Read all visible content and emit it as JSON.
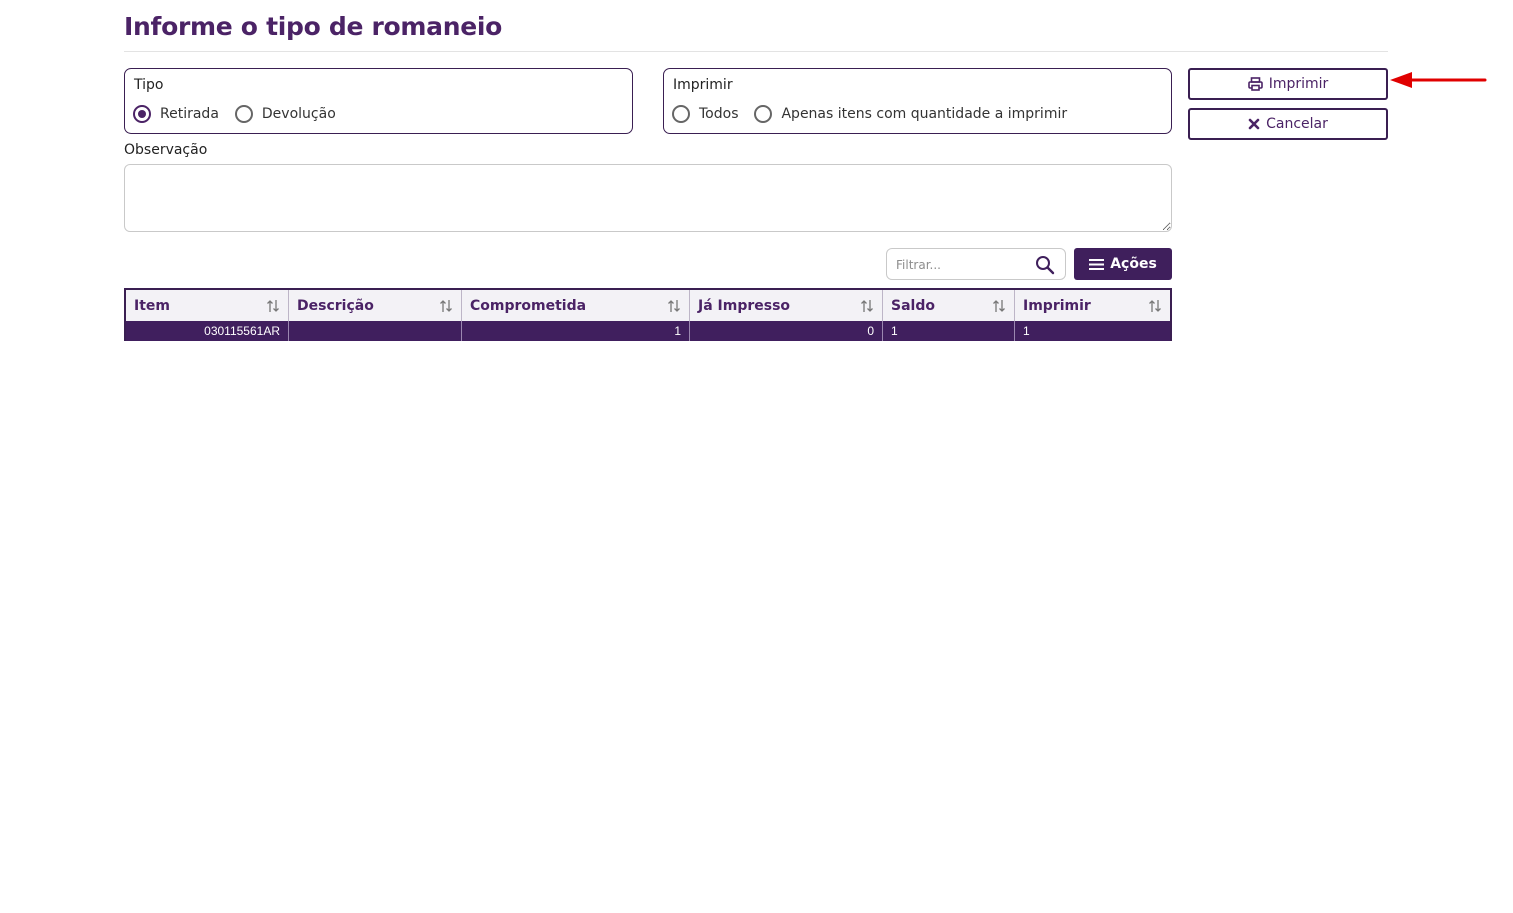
{
  "page": {
    "title": "Informe o tipo de romaneio"
  },
  "tipo": {
    "label": "Tipo",
    "options": [
      {
        "label": "Retirada",
        "checked": true
      },
      {
        "label": "Devolução",
        "checked": false
      }
    ]
  },
  "imprimir_group": {
    "label": "Imprimir",
    "options": [
      {
        "label": "Todos",
        "checked": false
      },
      {
        "label": "Apenas itens com quantidade a imprimir",
        "checked": false
      }
    ]
  },
  "actions": {
    "print_label": "Imprimir",
    "cancel_label": "Cancelar",
    "acoes_label": "Ações"
  },
  "observacao": {
    "label": "Observação",
    "value": ""
  },
  "filter": {
    "placeholder": "Filtrar...",
    "value": ""
  },
  "table": {
    "columns": [
      "Item",
      "Descrição",
      "Comprometida",
      "Já Impresso",
      "Saldo",
      "Imprimir"
    ],
    "rows": [
      {
        "item": "030115561AR",
        "descricao": "",
        "comprometida": "1",
        "ja_impresso": "0",
        "saldo": "1",
        "imprimir": "1"
      }
    ]
  },
  "colors": {
    "primary": "#4b2366",
    "primary_dark": "#3f1f5c",
    "annotation": "#e00000"
  },
  "icons": {
    "print": "printer-icon",
    "cancel": "times-icon",
    "menu": "bars-icon",
    "search": "search-icon",
    "sort": "sort-icon"
  }
}
